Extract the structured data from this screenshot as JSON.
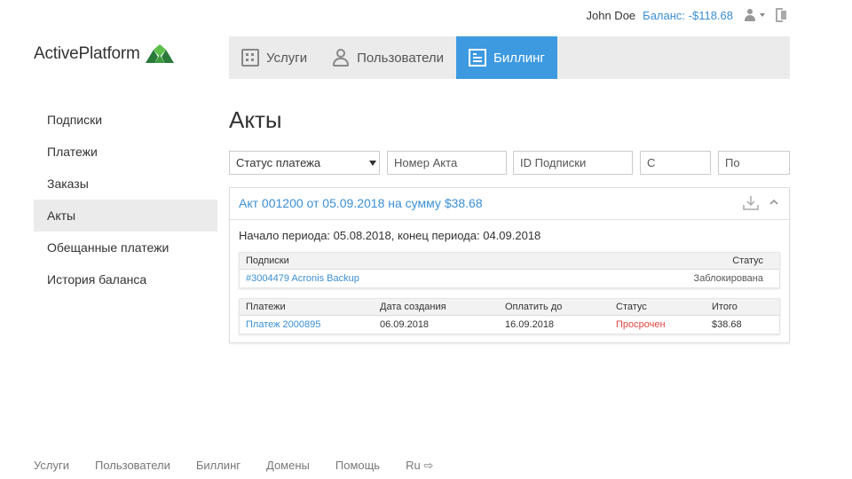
{
  "topbar": {
    "user_name": "John Doe",
    "balance": "Баланс: -$118.68",
    "user_icon": "user-icon",
    "logout_icon": "logout-icon"
  },
  "logo": {
    "text": "ActivePlatform",
    "colors": {
      "dark": "#2a7a3a",
      "light": "#5cbf4a"
    }
  },
  "main_nav": {
    "tabs": [
      {
        "label": "Услуги",
        "icon": "services-icon"
      },
      {
        "label": "Пользователи",
        "icon": "users-icon"
      },
      {
        "label": "Биллинг",
        "icon": "billing-icon",
        "active": true
      }
    ],
    "accent": "#3d9ae0"
  },
  "sidebar": {
    "items": [
      {
        "label": "Подписки"
      },
      {
        "label": "Платежи"
      },
      {
        "label": "Заказы"
      },
      {
        "label": "Акты",
        "active": true
      },
      {
        "label": "Обещанные платежи"
      },
      {
        "label": "История баланса"
      }
    ]
  },
  "page": {
    "title": "Акты"
  },
  "filters": {
    "status_select": {
      "value": "Статус платежа"
    },
    "act_number": {
      "placeholder": "Номер Акта"
    },
    "subscription_id": {
      "placeholder": "ID Подписки"
    },
    "date_from": {
      "placeholder": "С"
    },
    "date_to": {
      "placeholder": "По"
    }
  },
  "act": {
    "title": "Акт 001200 от 05.09.2018 на сумму $38.68",
    "period": "Начало периода: 05.08.2018, конец периода: 04.09.2018",
    "subscriptions": {
      "headers": {
        "name": "Подписки",
        "status": "Статус"
      },
      "rows": [
        {
          "name": "#3004479 Acronis Backup",
          "status": "Заблокирована"
        }
      ]
    },
    "payments": {
      "headers": {
        "name": "Платежи",
        "created": "Дата создания",
        "due": "Оплатить до",
        "status": "Статус",
        "total": "Итого"
      },
      "rows": [
        {
          "name": "Платеж 2000895",
          "created": "06.09.2018",
          "due": "16.09.2018",
          "status": "Просрочен",
          "total": "$38.68"
        }
      ]
    },
    "status_colors": {
      "overdue": "#e0443f"
    }
  },
  "footer": {
    "links": [
      {
        "label": "Услуги"
      },
      {
        "label": "Пользователи"
      },
      {
        "label": "Биллинг"
      },
      {
        "label": "Домены"
      },
      {
        "label": "Помощь"
      },
      {
        "label": "Ru ⇨"
      }
    ]
  }
}
